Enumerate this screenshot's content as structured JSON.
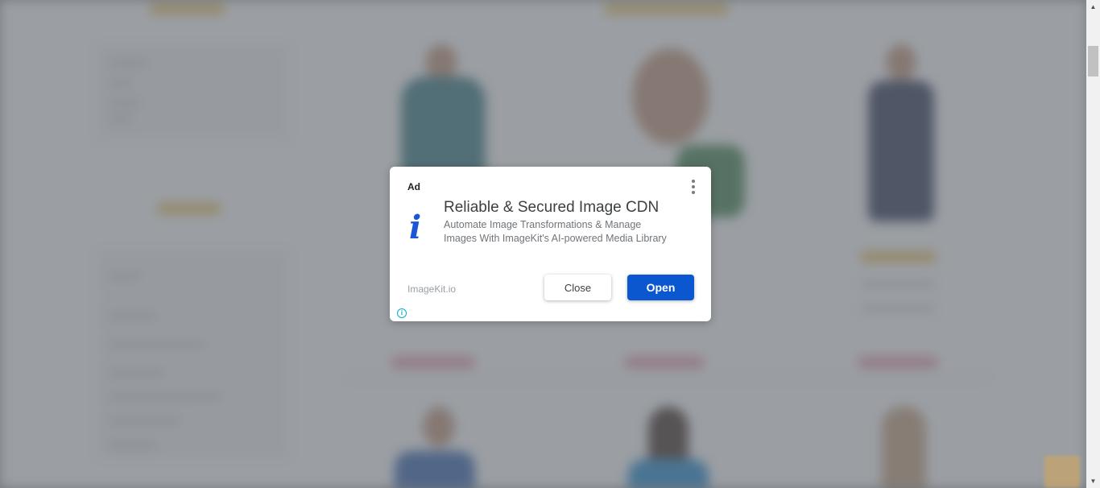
{
  "ad": {
    "badge": "Ad",
    "icon": "info-italic-icon",
    "title": "Reliable & Secured Image CDN",
    "description": "Automate Image Transformations & Manage Images With ImageKit's AI-powered Media Library",
    "source": "ImageKit.io",
    "close_label": "Close",
    "open_label": "Open",
    "info_glyph": "i",
    "accent_color": "#0b57d0"
  },
  "scrollbar": {
    "up_glyph": "▲",
    "down_glyph": "▼"
  }
}
